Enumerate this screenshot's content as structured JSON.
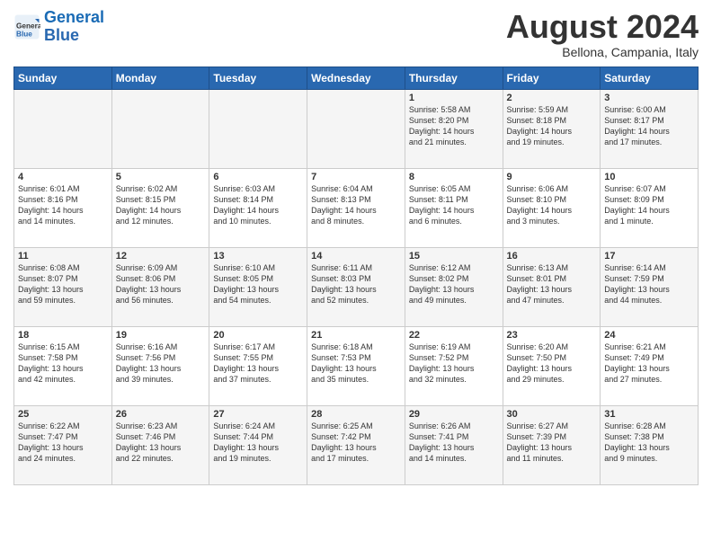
{
  "header": {
    "logo_line1": "General",
    "logo_line2": "Blue",
    "month_title": "August 2024",
    "subtitle": "Bellona, Campania, Italy"
  },
  "weekdays": [
    "Sunday",
    "Monday",
    "Tuesday",
    "Wednesday",
    "Thursday",
    "Friday",
    "Saturday"
  ],
  "weeks": [
    [
      {
        "day": "",
        "info": ""
      },
      {
        "day": "",
        "info": ""
      },
      {
        "day": "",
        "info": ""
      },
      {
        "day": "",
        "info": ""
      },
      {
        "day": "1",
        "info": "Sunrise: 5:58 AM\nSunset: 8:20 PM\nDaylight: 14 hours\nand 21 minutes."
      },
      {
        "day": "2",
        "info": "Sunrise: 5:59 AM\nSunset: 8:18 PM\nDaylight: 14 hours\nand 19 minutes."
      },
      {
        "day": "3",
        "info": "Sunrise: 6:00 AM\nSunset: 8:17 PM\nDaylight: 14 hours\nand 17 minutes."
      }
    ],
    [
      {
        "day": "4",
        "info": "Sunrise: 6:01 AM\nSunset: 8:16 PM\nDaylight: 14 hours\nand 14 minutes."
      },
      {
        "day": "5",
        "info": "Sunrise: 6:02 AM\nSunset: 8:15 PM\nDaylight: 14 hours\nand 12 minutes."
      },
      {
        "day": "6",
        "info": "Sunrise: 6:03 AM\nSunset: 8:14 PM\nDaylight: 14 hours\nand 10 minutes."
      },
      {
        "day": "7",
        "info": "Sunrise: 6:04 AM\nSunset: 8:13 PM\nDaylight: 14 hours\nand 8 minutes."
      },
      {
        "day": "8",
        "info": "Sunrise: 6:05 AM\nSunset: 8:11 PM\nDaylight: 14 hours\nand 6 minutes."
      },
      {
        "day": "9",
        "info": "Sunrise: 6:06 AM\nSunset: 8:10 PM\nDaylight: 14 hours\nand 3 minutes."
      },
      {
        "day": "10",
        "info": "Sunrise: 6:07 AM\nSunset: 8:09 PM\nDaylight: 14 hours\nand 1 minute."
      }
    ],
    [
      {
        "day": "11",
        "info": "Sunrise: 6:08 AM\nSunset: 8:07 PM\nDaylight: 13 hours\nand 59 minutes."
      },
      {
        "day": "12",
        "info": "Sunrise: 6:09 AM\nSunset: 8:06 PM\nDaylight: 13 hours\nand 56 minutes."
      },
      {
        "day": "13",
        "info": "Sunrise: 6:10 AM\nSunset: 8:05 PM\nDaylight: 13 hours\nand 54 minutes."
      },
      {
        "day": "14",
        "info": "Sunrise: 6:11 AM\nSunset: 8:03 PM\nDaylight: 13 hours\nand 52 minutes."
      },
      {
        "day": "15",
        "info": "Sunrise: 6:12 AM\nSunset: 8:02 PM\nDaylight: 13 hours\nand 49 minutes."
      },
      {
        "day": "16",
        "info": "Sunrise: 6:13 AM\nSunset: 8:01 PM\nDaylight: 13 hours\nand 47 minutes."
      },
      {
        "day": "17",
        "info": "Sunrise: 6:14 AM\nSunset: 7:59 PM\nDaylight: 13 hours\nand 44 minutes."
      }
    ],
    [
      {
        "day": "18",
        "info": "Sunrise: 6:15 AM\nSunset: 7:58 PM\nDaylight: 13 hours\nand 42 minutes."
      },
      {
        "day": "19",
        "info": "Sunrise: 6:16 AM\nSunset: 7:56 PM\nDaylight: 13 hours\nand 39 minutes."
      },
      {
        "day": "20",
        "info": "Sunrise: 6:17 AM\nSunset: 7:55 PM\nDaylight: 13 hours\nand 37 minutes."
      },
      {
        "day": "21",
        "info": "Sunrise: 6:18 AM\nSunset: 7:53 PM\nDaylight: 13 hours\nand 35 minutes."
      },
      {
        "day": "22",
        "info": "Sunrise: 6:19 AM\nSunset: 7:52 PM\nDaylight: 13 hours\nand 32 minutes."
      },
      {
        "day": "23",
        "info": "Sunrise: 6:20 AM\nSunset: 7:50 PM\nDaylight: 13 hours\nand 29 minutes."
      },
      {
        "day": "24",
        "info": "Sunrise: 6:21 AM\nSunset: 7:49 PM\nDaylight: 13 hours\nand 27 minutes."
      }
    ],
    [
      {
        "day": "25",
        "info": "Sunrise: 6:22 AM\nSunset: 7:47 PM\nDaylight: 13 hours\nand 24 minutes."
      },
      {
        "day": "26",
        "info": "Sunrise: 6:23 AM\nSunset: 7:46 PM\nDaylight: 13 hours\nand 22 minutes."
      },
      {
        "day": "27",
        "info": "Sunrise: 6:24 AM\nSunset: 7:44 PM\nDaylight: 13 hours\nand 19 minutes."
      },
      {
        "day": "28",
        "info": "Sunrise: 6:25 AM\nSunset: 7:42 PM\nDaylight: 13 hours\nand 17 minutes."
      },
      {
        "day": "29",
        "info": "Sunrise: 6:26 AM\nSunset: 7:41 PM\nDaylight: 13 hours\nand 14 minutes."
      },
      {
        "day": "30",
        "info": "Sunrise: 6:27 AM\nSunset: 7:39 PM\nDaylight: 13 hours\nand 11 minutes."
      },
      {
        "day": "31",
        "info": "Sunrise: 6:28 AM\nSunset: 7:38 PM\nDaylight: 13 hours\nand 9 minutes."
      }
    ]
  ]
}
